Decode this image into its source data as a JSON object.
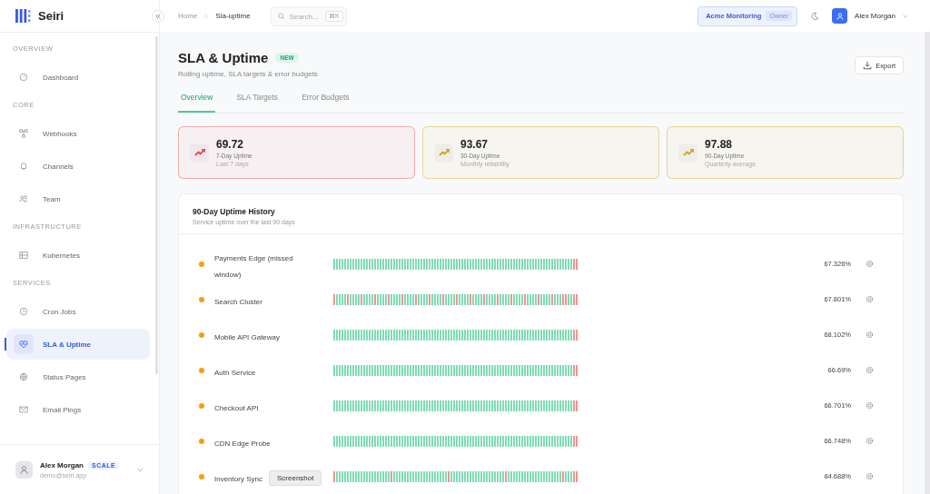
{
  "brand": {
    "name": "Seiri"
  },
  "sidebar": {
    "sections": [
      {
        "title": "OVERVIEW",
        "items": [
          {
            "label": "Dashboard",
            "selected": false
          }
        ]
      },
      {
        "title": "CORE",
        "items": [
          {
            "label": "Webhooks",
            "selected": false
          },
          {
            "label": "Channels",
            "selected": false
          },
          {
            "label": "Team",
            "selected": false
          }
        ]
      },
      {
        "title": "INFRASTRUCTURE",
        "items": [
          {
            "label": "Kubernetes",
            "selected": false
          }
        ]
      },
      {
        "title": "SERVICES",
        "items": [
          {
            "label": "Cron Jobs",
            "selected": false
          },
          {
            "label": "SLA & Uptime",
            "selected": true
          },
          {
            "label": "Status Pages",
            "selected": false
          },
          {
            "label": "Email Pings",
            "selected": false
          }
        ]
      }
    ],
    "user": {
      "name": "Alex Morgan",
      "plan": "SCALE",
      "email": "demo@seiri.app"
    }
  },
  "topbar": {
    "breadcrumb": [
      "Home",
      "Sla-uptime"
    ],
    "search": {
      "placeholder": "Search...",
      "shortcut": "⌘K"
    },
    "workspace": "Acme Monitoring",
    "role": "Owner",
    "user": "Alex Morgan"
  },
  "page": {
    "title": "SLA & Uptime",
    "badge": "NEW",
    "subtitle": "Rolling uptime, SLA targets & error budgets",
    "export": "Export"
  },
  "tabs": [
    {
      "label": "Overview",
      "selected": true
    },
    {
      "label": "SLA Targets",
      "selected": false
    },
    {
      "label": "Error Budgets",
      "selected": false
    }
  ],
  "stats": [
    {
      "value": "69.72",
      "label": "7-Day Uptime",
      "note": "Last 7 days",
      "color": "#e5484d"
    },
    {
      "value": "93.67",
      "label": "30-Day Uptime",
      "note": "Monthly reliability",
      "color": "#d6a21e"
    },
    {
      "value": "97.88",
      "label": "90-Day Uptime",
      "note": "Quarterly average",
      "color": "#d6a21e"
    }
  ],
  "history": {
    "title": "90-Day Uptime History",
    "subtitle": "Service uptime over the last 90 days",
    "rows": [
      {
        "name": "Payments Edge (missed window)",
        "color": "#f59e0b",
        "uptime": "67.326%"
      },
      {
        "name": "Search Cluster",
        "color": "#f59e0b",
        "uptime": "67.801%"
      },
      {
        "name": "Mobile API Gateway",
        "color": "#f59e0b",
        "uptime": "68.102%"
      },
      {
        "name": "Auth Service",
        "color": "#f59e0b",
        "uptime": "66.69%"
      },
      {
        "name": "Checkout API",
        "color": "#f59e0b",
        "uptime": "66.701%"
      },
      {
        "name": "CDN Edge Probe",
        "color": "#f59e0b",
        "uptime": "66.748%"
      },
      {
        "name": "Inventory Sync",
        "color": "#f59e0b",
        "uptime": "84.688%"
      }
    ]
  },
  "tooltip": "Screenshot"
}
